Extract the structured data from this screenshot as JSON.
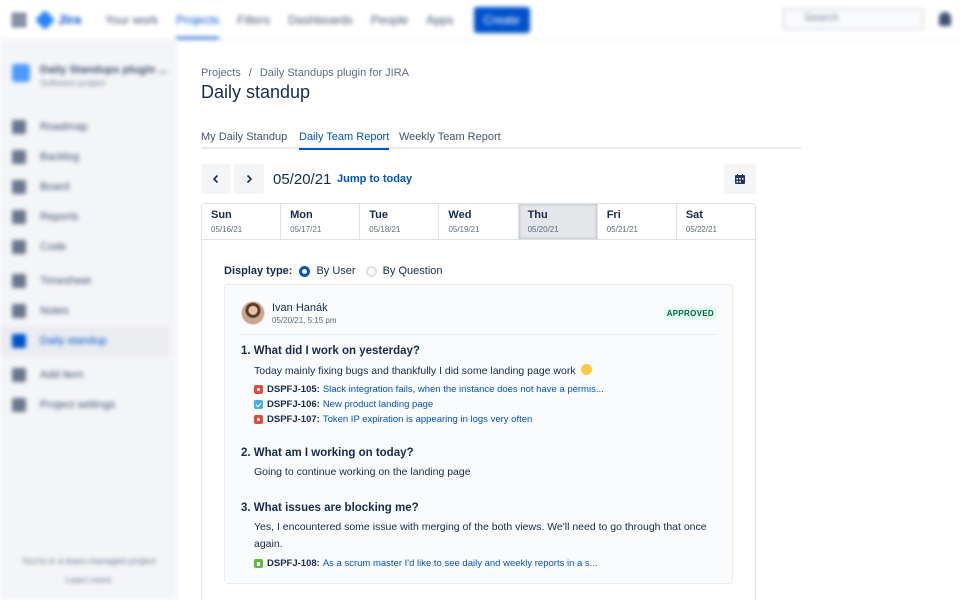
{
  "topnav": {
    "logo_text": "Jira",
    "items": [
      "Your work",
      "Projects",
      "Filters",
      "Dashboards",
      "People",
      "Apps"
    ],
    "create_label": "Create",
    "search_placeholder": "Search"
  },
  "sidebar": {
    "project_name": "Daily Standups plugin ...",
    "project_type": "Software project",
    "items": [
      "Roadmap",
      "Backlog",
      "Board",
      "Reports",
      "Code",
      "Timesheet",
      "Notes",
      "Daily standup",
      "Add item",
      "Project settings"
    ],
    "footer_line1": "You're in a team-managed project",
    "footer_line2": "Learn more"
  },
  "breadcrumb": {
    "root": "Projects",
    "separator": "/",
    "project": "Daily Standups plugin for JIRA"
  },
  "page_title": "Daily standup",
  "tabs": {
    "my": "My Daily Standup",
    "team": "Daily Team Report",
    "weekly": "Weekly Team Report"
  },
  "date_nav": {
    "prev_symbol": "‹",
    "next_symbol": "›",
    "current_date": "05/20/21",
    "jump_label": "Jump to today"
  },
  "days": [
    {
      "name": "Sun",
      "date": "05/16/21"
    },
    {
      "name": "Mon",
      "date": "05/17/21"
    },
    {
      "name": "Tue",
      "date": "05/18/21"
    },
    {
      "name": "Wed",
      "date": "05/19/21"
    },
    {
      "name": "Thu",
      "date": "05/20/21"
    },
    {
      "name": "Fri",
      "date": "05/21/21"
    },
    {
      "name": "Sat",
      "date": "05/22/21"
    }
  ],
  "selected_day": "Thu",
  "display_type": {
    "label": "Display type:",
    "options": [
      "By User",
      "By Question"
    ],
    "selected": "By User"
  },
  "report": {
    "user_name": "Ivan Hanák",
    "timestamp": "05/20/21, 5:15 pm",
    "status": "APPROVED",
    "questions": [
      {
        "title": "1. What did I work on yesterday?",
        "answer": "Today mainly fixing bugs and thankfully I did some landing page work",
        "issues": [
          {
            "type": "bug-icon",
            "key": "DSPFJ-105:",
            "summary": "Slack integration fails, when the instance does not have a permis..."
          },
          {
            "type": "task-icon",
            "key": "DSPFJ-106:",
            "summary": "New product landing page"
          },
          {
            "type": "bug-icon",
            "key": "DSPFJ-107:",
            "summary": "Token IP expiration is appearing in logs very often"
          }
        ]
      },
      {
        "title": "2. What am I working on today?",
        "answer": "Going to continue working on the landing page",
        "issues": []
      },
      {
        "title": "3. What issues are blocking me?",
        "answer": "Yes, I encountered some issue with merging of the both views. We'll need to go through that once again.",
        "issues": [
          {
            "type": "story-icon",
            "key": "DSPFJ-108:",
            "summary": "As a scrum master I'd like to see daily and weekly reports in a s..."
          }
        ]
      }
    ]
  },
  "colors": {
    "brand": "#0052cc",
    "approved_bg": "#e3fcef",
    "approved_text": "#006644",
    "bug": "#e5493a",
    "task": "#4bade8",
    "story": "#63ba3c"
  }
}
